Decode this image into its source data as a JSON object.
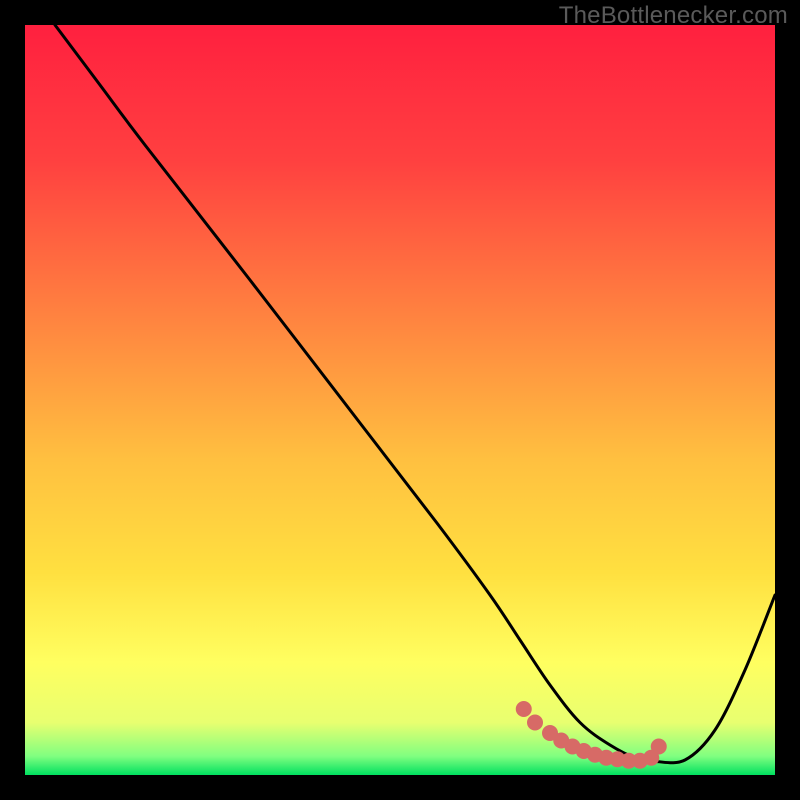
{
  "watermark": "TheBottlenecker.com",
  "chart_data": {
    "type": "line",
    "title": "",
    "xlabel": "",
    "ylabel": "",
    "xlim": [
      0,
      100
    ],
    "ylim": [
      0,
      100
    ],
    "gradient_stops": [
      {
        "offset": 0.0,
        "color": "#ff203f"
      },
      {
        "offset": 0.18,
        "color": "#ff4040"
      },
      {
        "offset": 0.38,
        "color": "#ff8040"
      },
      {
        "offset": 0.58,
        "color": "#ffc040"
      },
      {
        "offset": 0.73,
        "color": "#ffe040"
      },
      {
        "offset": 0.85,
        "color": "#ffff60"
      },
      {
        "offset": 0.93,
        "color": "#e8ff70"
      },
      {
        "offset": 0.975,
        "color": "#80ff80"
      },
      {
        "offset": 1.0,
        "color": "#00e060"
      }
    ],
    "series": [
      {
        "name": "curve",
        "x": [
          4.0,
          10.0,
          16.0,
          30.0,
          45.0,
          55.0,
          62.0,
          66.0,
          70.0,
          74.0,
          78.0,
          82.0,
          84.0,
          88.0,
          92.0,
          96.0,
          100.0
        ],
        "y": [
          100.0,
          92.0,
          84.0,
          66.0,
          46.5,
          33.5,
          24.0,
          18.0,
          12.0,
          7.0,
          4.0,
          2.0,
          1.8,
          2.0,
          6.0,
          14.0,
          24.0
        ]
      }
    ],
    "markers": {
      "name": "valley-dots",
      "color": "#d76a66",
      "radius": 8,
      "x": [
        66.5,
        68.0,
        70.0,
        71.5,
        73.0,
        74.5,
        76.0,
        77.5,
        79.0,
        80.5,
        82.0,
        83.5,
        84.5
      ],
      "y": [
        8.8,
        7.0,
        5.6,
        4.6,
        3.8,
        3.2,
        2.7,
        2.3,
        2.1,
        1.9,
        1.9,
        2.3,
        3.8
      ]
    }
  }
}
